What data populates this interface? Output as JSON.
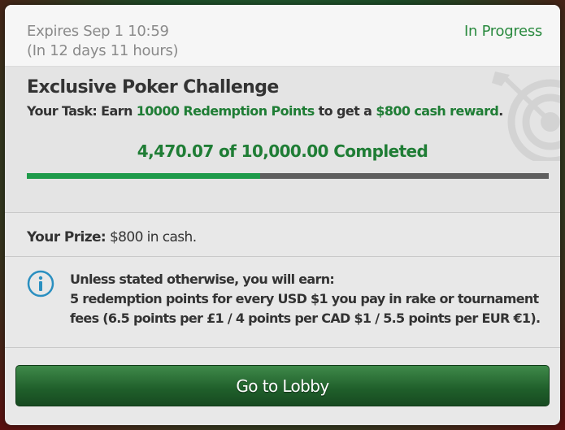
{
  "header": {
    "expires_line1": "Expires Sep 1 10:59",
    "expires_line2": "(In 12 days 11 hours)",
    "status": "In Progress"
  },
  "challenge": {
    "title": "Exclusive Poker Challenge",
    "task_prefix": "Your Task: Earn ",
    "task_points": "10000 Redemption Points",
    "task_mid": " to get a ",
    "task_reward": "$800 cash reward",
    "task_suffix": ".",
    "completed_text": "4,470.07 of 10,000.00 Completed",
    "progress_fraction": 0.447,
    "icon": "target-arrow-icon"
  },
  "prize": {
    "label": "Your Prize:",
    "value": " $800 in cash."
  },
  "info": {
    "icon": "info-icon",
    "line1": "Unless stated otherwise, you will earn:",
    "line2": "5 redemption points for every USD $1 you pay in rake or tournament",
    "line3": "fees (6.5 points per £1 / 4 points per CAD $1 / 5.5 points per EUR €1)."
  },
  "actions": {
    "lobby_label": "Go to Lobby"
  },
  "colors": {
    "accent_green": "#1f7d35",
    "progress_fill": "#1e9a4a",
    "progress_track": "#5e5e5e",
    "info_icon": "#2a8fc0"
  }
}
